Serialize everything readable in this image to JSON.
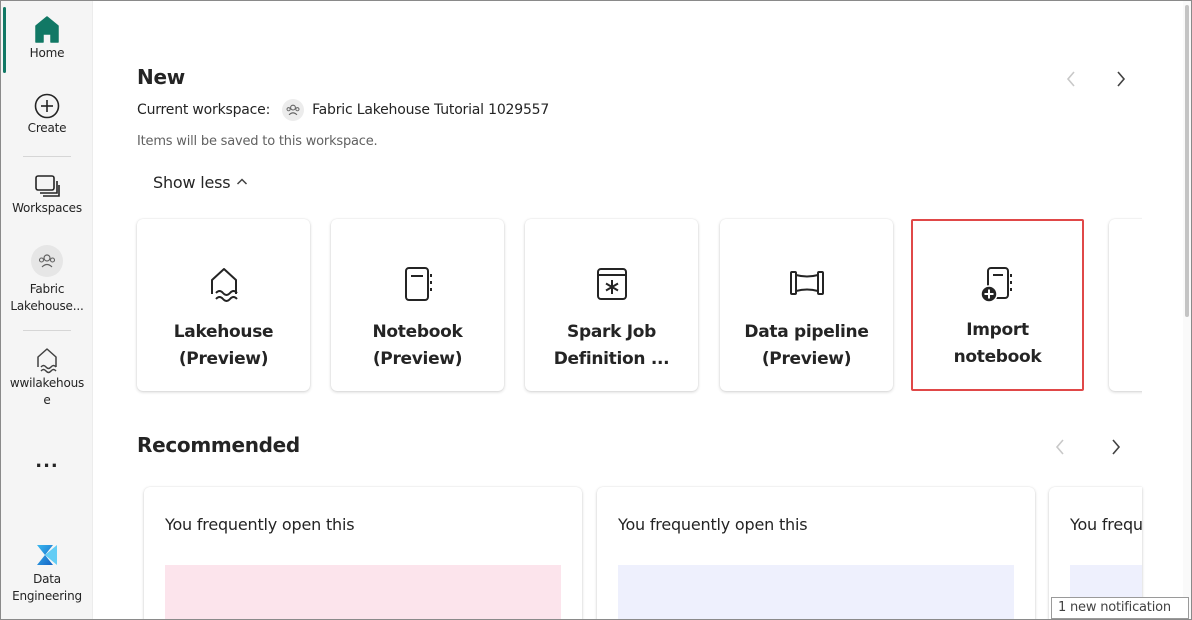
{
  "rail": {
    "home_label": "Home",
    "create_label": "Create",
    "workspaces_label": "Workspaces",
    "fabric_label_1": "Fabric",
    "fabric_label_2": "Lakehouse...",
    "lakehouse_label_1": "wwilakehous",
    "lakehouse_label_2": "e",
    "more_label": "...",
    "experience_label_1": "Data",
    "experience_label_2": "Engineering",
    "accent_color": "#117865"
  },
  "new_section": {
    "title": "New",
    "workspace_prefix": "Current workspace:",
    "workspace_name": "Fabric Lakehouse Tutorial 1029557",
    "hint": "Items will be saved to this workspace.",
    "show_less": "Show less",
    "cards": [
      {
        "line1": "Lakehouse",
        "line2": "(Preview)",
        "icon": "lakehouse-icon"
      },
      {
        "line1": "Notebook",
        "line2": "(Preview)",
        "icon": "notebook-icon"
      },
      {
        "line1": "Spark Job",
        "line2": "Definition ...",
        "icon": "spark-job-icon"
      },
      {
        "line1": "Data pipeline",
        "line2": "(Preview)",
        "icon": "pipeline-icon"
      },
      {
        "line1": "Import notebook",
        "line2": "",
        "icon": "import-notebook-icon",
        "highlight_color": "#e04848"
      }
    ]
  },
  "recommended_section": {
    "title": "Recommended",
    "cards": [
      {
        "text": "You frequently open this",
        "thumb_color": "#fce4ec"
      },
      {
        "text": "You frequently open this",
        "thumb_color": "#eef0fd"
      },
      {
        "text": "You frequ",
        "thumb_color": "#eef0fd"
      }
    ]
  },
  "notification": {
    "text": "1 new notification"
  }
}
